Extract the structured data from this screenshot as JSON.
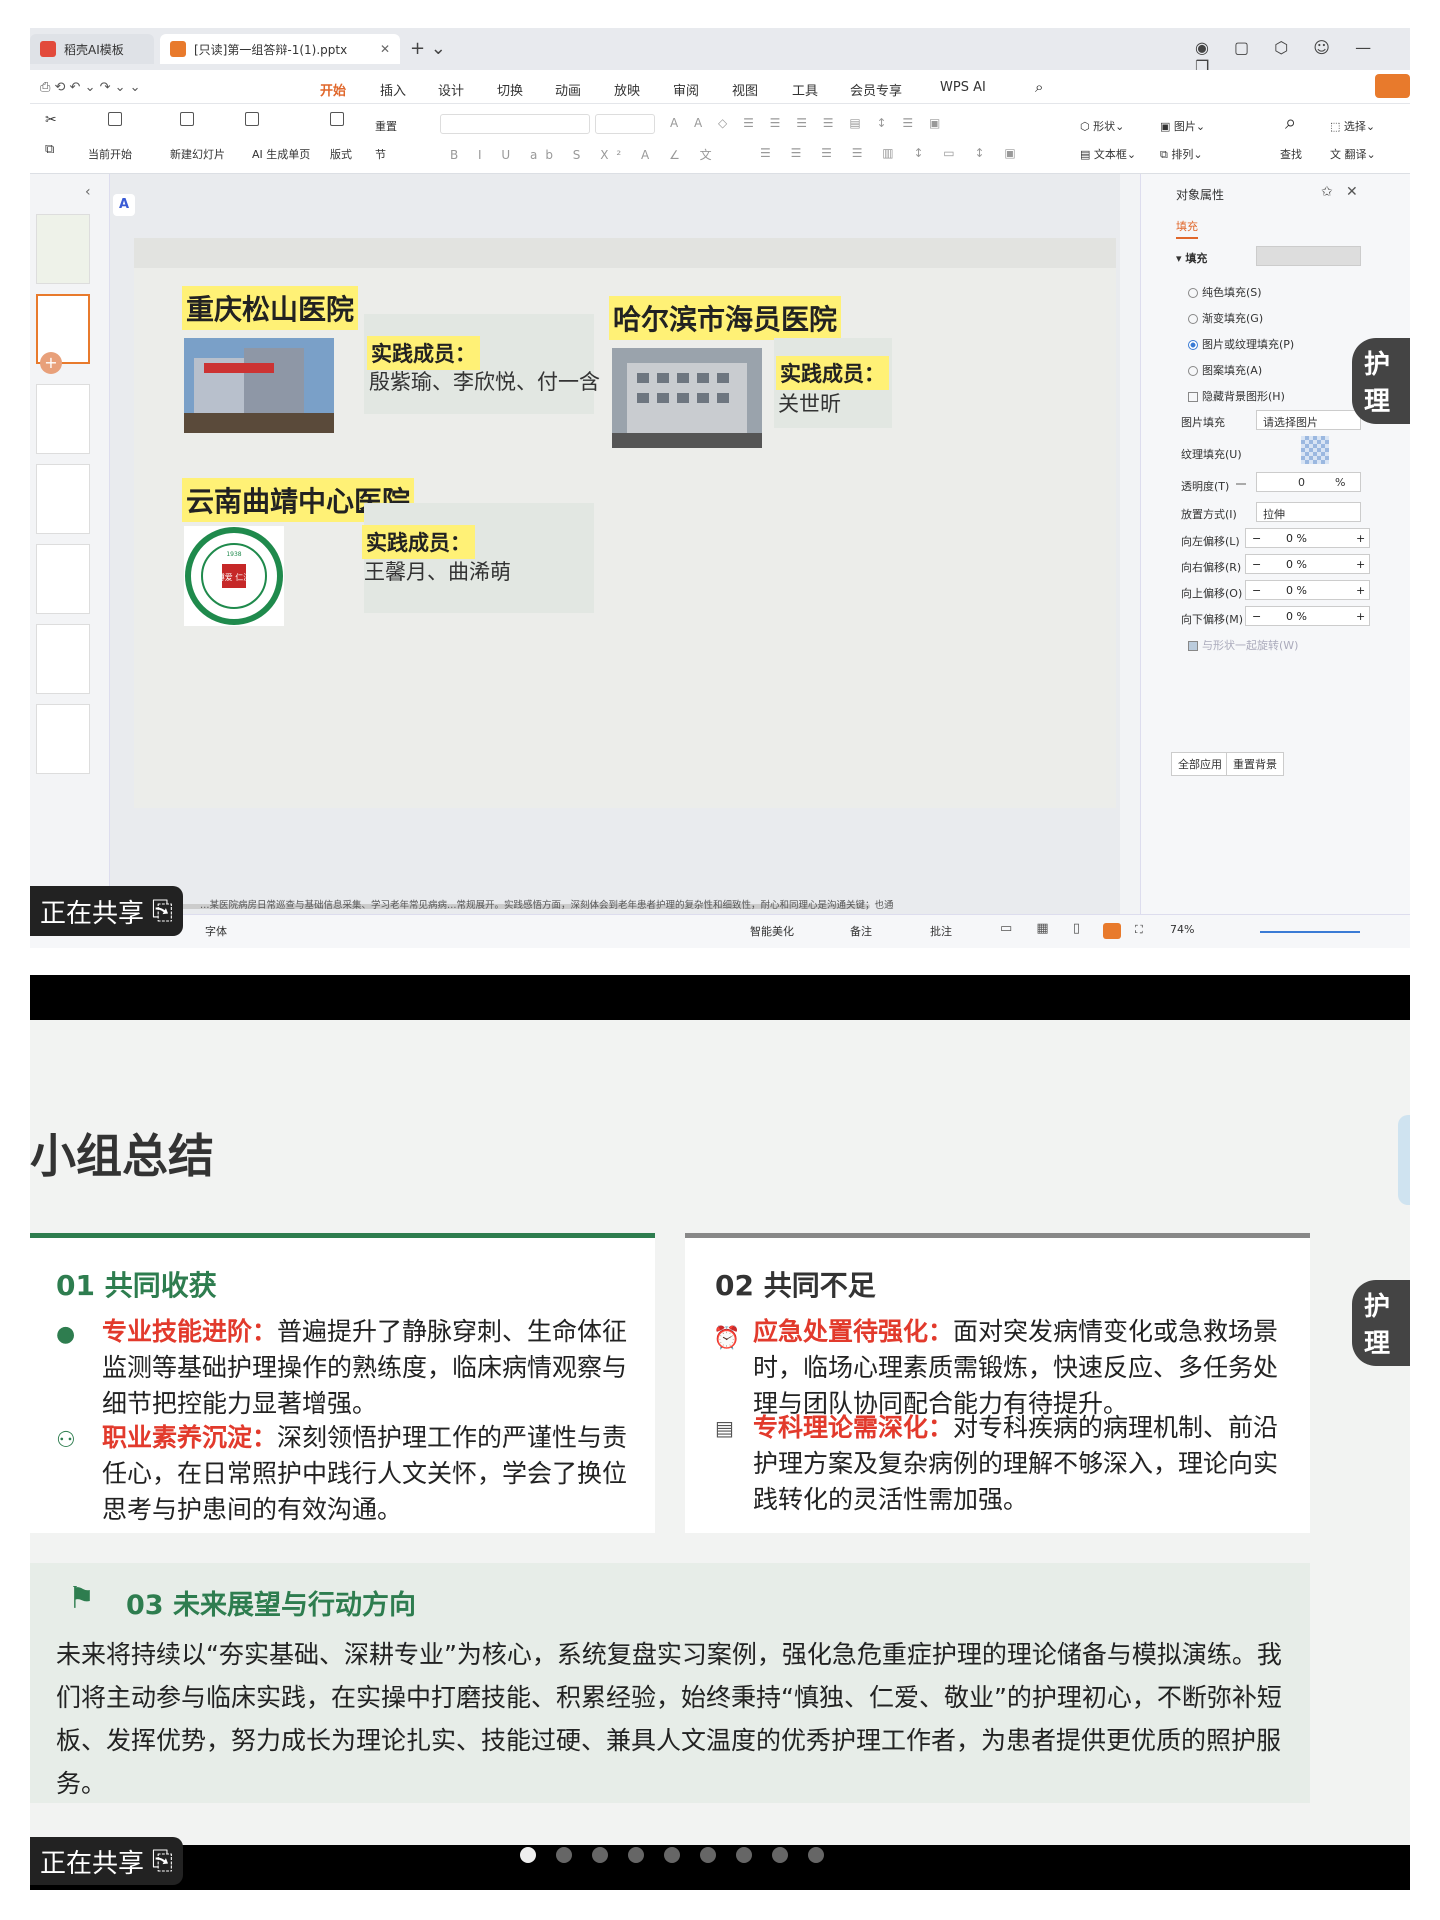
{
  "top": {
    "tabs": [
      {
        "label": "稻壳AI模板"
      },
      {
        "label": "[只读]第一组答辩-1(1).pptx"
      }
    ],
    "menu": [
      "开始",
      "插入",
      "设计",
      "切换",
      "动画",
      "放映",
      "审阅",
      "视图",
      "工具",
      "会员专享",
      "WPS AI"
    ],
    "toolbar": {
      "current_start": "当前开始",
      "new_slide": "新建幻灯片",
      "ai_page": "AI 生成单页",
      "layout": "版式",
      "reset": "重置",
      "section": "节",
      "shape": "形状",
      "picture": "图片",
      "textbox": "文本框",
      "arrange": "排列",
      "find": "查找",
      "select": "选择",
      "translate": "翻译"
    },
    "slide": {
      "h1": "重庆松山医院",
      "h1_label": "实践成员：",
      "h1_members": "殷紫瑜、李欣悦、付一含",
      "h2": "哈尔滨市海员医院",
      "h2_label": "实践成员：",
      "h2_members": "关世昕",
      "h3": "云南曲靖中心医院",
      "h3_label": "实践成员：",
      "h3_members": "王馨月、曲浠萌",
      "seal_year": "1938",
      "seal_center": "博爱 仁济"
    },
    "props": {
      "title": "对象属性",
      "tab": "填充",
      "section": "填充",
      "options": [
        "纯色填充(S)",
        "渐变填充(G)",
        "图片或纹理填充(P)",
        "图案填充(A)"
      ],
      "hide_bg": "隐藏背景图形(H)",
      "pic_fill": "图片填充",
      "pic_fill_value": "请选择图片",
      "texture": "纹理填充(U)",
      "transparency": "透明度(T)",
      "transparency_value": "0",
      "percent": "%",
      "placement": "放置方式(I)",
      "placement_value": "拉伸",
      "offsets": [
        {
          "label": "向左偏移(L)",
          "value": "0 %"
        },
        {
          "label": "向右偏移(R)",
          "value": "0 %"
        },
        {
          "label": "向上偏移(O)",
          "value": "0 %"
        },
        {
          "label": "向下偏移(M)",
          "value": "0 %"
        }
      ],
      "rotate": "与形状一起旋转(W)",
      "apply_all": "全部应用",
      "reset_bg": "重置背景"
    },
    "notes": "…某医院病房日常巡查与基础信息采集、学习老年常见病病…常规展开。实践感悟方面，深刻体会到老年患者护理的复杂性和细致性，耐心和同理心是沟通关键；也通",
    "status": {
      "font": "字体",
      "beautify": "智能美化",
      "notes": "备注",
      "comment": "批注",
      "zoom": "74%"
    },
    "share": "正在共享",
    "side_pill": "护理"
  },
  "bottom": {
    "title": "小组总结",
    "card1": {
      "heading": "01 共同收获",
      "items": [
        {
          "lead": "专业技能进阶：",
          "text": "普遍提升了静脉穿刺、生命体征监测等基础护理操作的熟练度，临床病情观察与细节把控能力显著增强。"
        },
        {
          "lead": "职业素养沉淀：",
          "text": "深刻领悟护理工作的严谨性与责任心，在日常照护中践行人文关怀，学会了换位思考与护患间的有效沟通。"
        }
      ]
    },
    "card2": {
      "heading": "02 共同不足",
      "items": [
        {
          "lead": "应急处置待强化：",
          "text": "面对突发病情变化或急救场景时，临场心理素质需锻炼，快速反应、多任务处理与团队协同配合能力有待提升。"
        },
        {
          "lead": "专科理论需深化：",
          "text": "对专科疾病的病理机制、前沿护理方案及复杂病例的理解不够深入，理论向实践转化的灵活性需加强。"
        }
      ]
    },
    "card3": {
      "heading": "03 未来展望与行动方向",
      "text": "未来将持续以“夯实基础、深耕专业”为核心，系统复盘实习案例，强化急危重症护理的理论储备与模拟演练。我们将主动参与临床实践，在实操中打磨技能、积累经验，始终秉持“慎独、仁爱、敬业”的护理初心，不断弥补短板、发挥优势，努力成长为理论扎实、技能过硬、兼具人文温度的优秀护理工作者，为患者提供更优质的照护服务。"
    },
    "share": "正在共享",
    "side_pill": "护理",
    "colors": {
      "green": "#2e7d4f",
      "red": "#e23a2c",
      "grey": "#888888"
    }
  }
}
